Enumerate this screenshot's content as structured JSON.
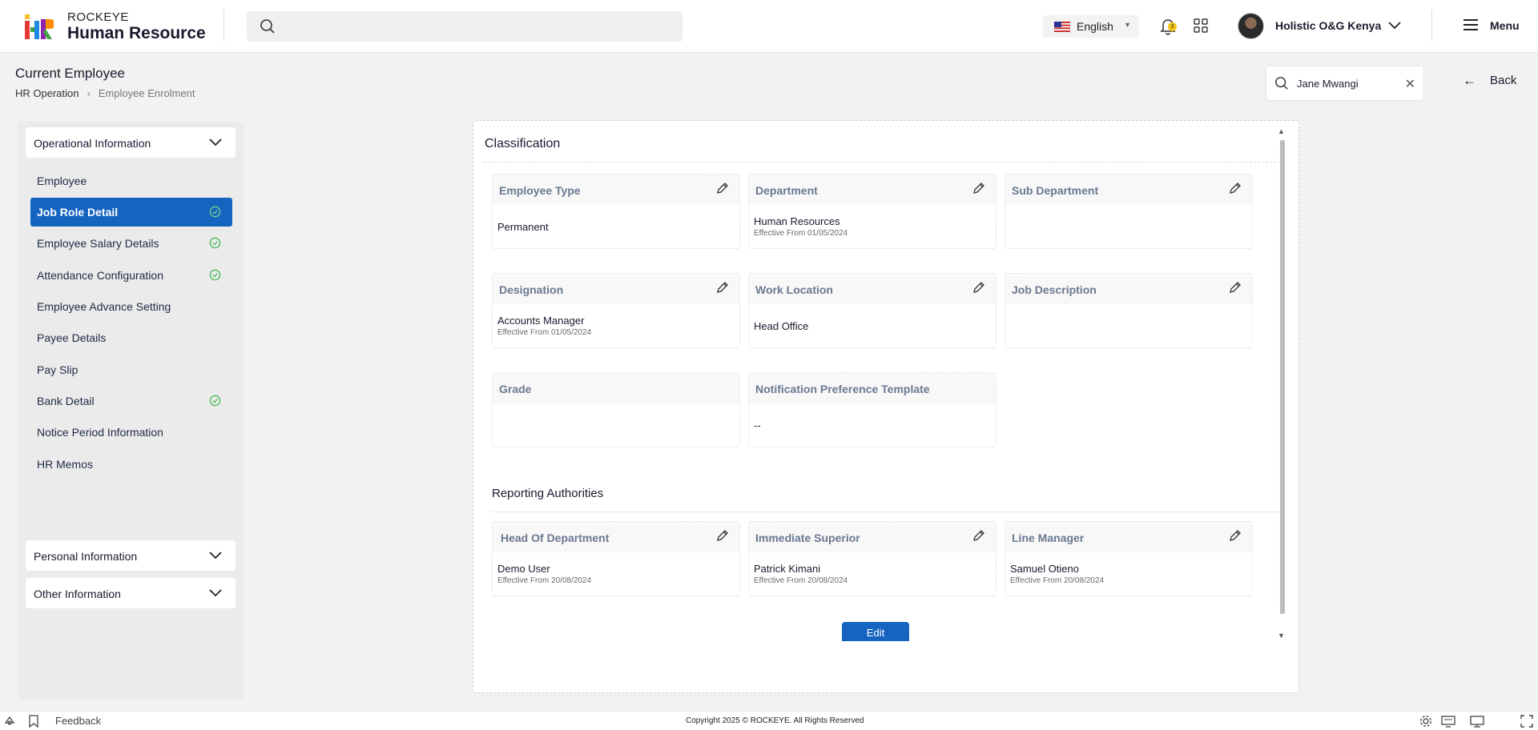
{
  "header": {
    "brand_top": "ROCKEYE",
    "brand_main": "Human Resource",
    "language": "English",
    "notification_count": "3",
    "org_name": "Holistic O&G Kenya",
    "menu_label": "Menu"
  },
  "page": {
    "title": "Current Employee",
    "breadcrumb": [
      "HR Operation",
      "Employee Enrolment"
    ],
    "employee_search_value": "Jane Mwangi",
    "back_label": "Back"
  },
  "sidebar": {
    "groups": [
      {
        "label": "Operational Information"
      },
      {
        "label": "Personal Information"
      },
      {
        "label": "Other Information"
      }
    ],
    "items": [
      {
        "label": "Employee",
        "done": false,
        "active": false
      },
      {
        "label": "Job Role Detail",
        "done": true,
        "active": true
      },
      {
        "label": "Employee Salary Details",
        "done": true,
        "active": false
      },
      {
        "label": "Attendance Configuration",
        "done": true,
        "active": false
      },
      {
        "label": "Employee Advance Setting",
        "done": false,
        "active": false
      },
      {
        "label": "Payee Details",
        "done": false,
        "active": false
      },
      {
        "label": "Pay Slip",
        "done": false,
        "active": false
      },
      {
        "label": "Bank Detail",
        "done": true,
        "active": false
      },
      {
        "label": "Notice Period Information",
        "done": false,
        "active": false
      },
      {
        "label": "HR Memos",
        "done": false,
        "active": false
      }
    ]
  },
  "classification": {
    "title": "Classification",
    "fields": [
      {
        "label": "Employee Type",
        "value": "Permanent",
        "sub": ""
      },
      {
        "label": "Department",
        "value": "Human Resources",
        "sub": "Effective From 01/05/2024"
      },
      {
        "label": "Sub Department",
        "value": "",
        "sub": ""
      },
      {
        "label": "Designation",
        "value": "Accounts Manager",
        "sub": "Effective From 01/05/2024"
      },
      {
        "label": "Work Location",
        "value": "Head Office",
        "sub": ""
      },
      {
        "label": "Job Description",
        "value": "",
        "sub": ""
      },
      {
        "label": "Grade",
        "value": "",
        "sub": ""
      },
      {
        "label": "Notification Preference Template",
        "value": "--",
        "sub": ""
      }
    ]
  },
  "reporting": {
    "title": "Reporting Authorities",
    "fields": [
      {
        "label": "Head Of Department",
        "value": "Demo User",
        "sub": "Effective From 20/08/2024"
      },
      {
        "label": "Immediate Superior",
        "value": "Patrick Kimani",
        "sub": "Effective From 20/08/2024"
      },
      {
        "label": "Line Manager",
        "value": "Samuel Otieno",
        "sub": "Effective From 20/08/2024"
      }
    ]
  },
  "edit_label": "Edit",
  "footer": {
    "feedback": "Feedback",
    "copyright": "Copyright 2025 © ROCKEYE. All Rights Reserved"
  },
  "colors": {
    "accent": "#1565c0",
    "check": "#3bb54a",
    "badge": "#f5c518"
  }
}
